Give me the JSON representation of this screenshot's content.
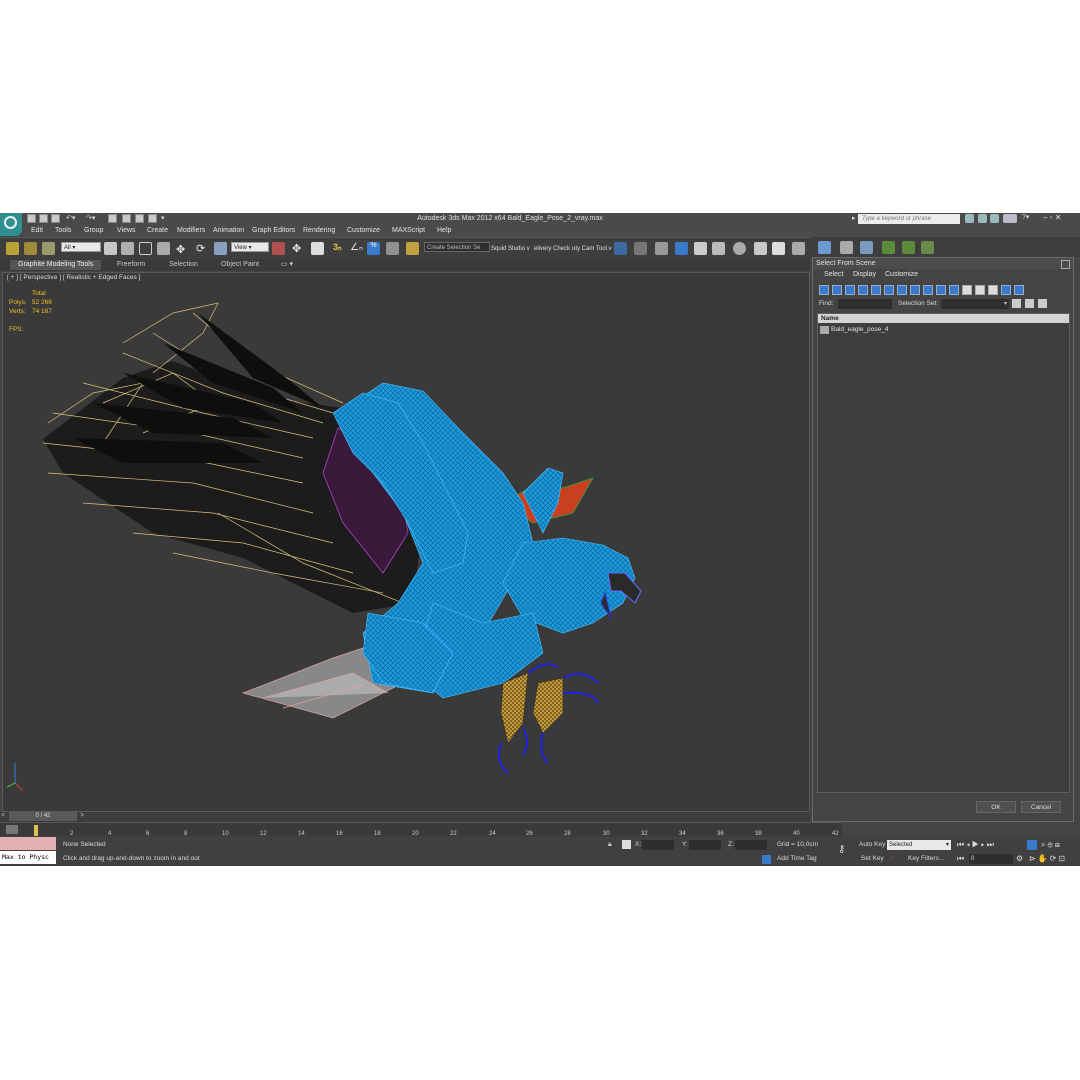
{
  "window": {
    "title": "Autodesk 3ds Max  2012 x64      Bald_Eagle_Pose_2_vray.max",
    "search_placeholder": "Type a keyword or phrase"
  },
  "menu": [
    "Edit",
    "Tools",
    "Group",
    "Views",
    "Create",
    "Modifiers",
    "Animation",
    "Graph Editors",
    "Rendering",
    "Customize",
    "MAXScript",
    "Help"
  ],
  "toolbar": {
    "selection_filter": "All",
    "ref_coord": "View",
    "named_selection": "Create Selection Se",
    "text_a": "Squid Studio v",
    "text_b": "elivery Check",
    "text_c": "uty Cam Tool v"
  },
  "ribbon": {
    "tabs": [
      "Graphite Modeling Tools",
      "Freeform",
      "Selection",
      "Object Paint"
    ]
  },
  "viewport": {
    "label": "[ + ] [ Perspective ] [ Realistic + Edged Faces ]",
    "stats": {
      "total_label": "Total",
      "polys_label": "Polys:",
      "polys_value": "52 266",
      "verts_label": "Verts:",
      "verts_value": "74 187",
      "fps_label": "FPS:"
    }
  },
  "timeline": {
    "frame": "0 / 42",
    "ticks": [
      "2",
      "4",
      "6",
      "8",
      "10",
      "12",
      "14",
      "16",
      "18",
      "20",
      "22",
      "24",
      "26",
      "28",
      "30",
      "32",
      "34",
      "36",
      "38",
      "40",
      "42"
    ]
  },
  "status": {
    "maxscript_listener": "Max to Physc",
    "selection": "None Selected",
    "prompt": "Click and drag up-and-down to zoom in and out",
    "x_label": "X:",
    "y_label": "Y:",
    "z_label": "Z:",
    "grid": "Grid = 10,0cm",
    "add_time_tag": "Add Time Tag",
    "auto_key": "Auto Key",
    "set_key": "Set Key",
    "key_mode": "Selected",
    "key_filters": "Key Filters...",
    "current_frame": "0"
  },
  "dialog": {
    "title": "Select From Scene",
    "menu": [
      "Select",
      "Display",
      "Customize"
    ],
    "find_label": "Find:",
    "selection_set_label": "Selection Set:",
    "column_name": "Name",
    "items": [
      "Bald_eagle_pose_4"
    ],
    "ok": "OK",
    "cancel": "Cancel"
  },
  "colors": {
    "wireframe": "#1a9be0",
    "wing_lines": "#d8c27a",
    "stats_text": "#f0c020",
    "accent_button": "#3a7acb"
  }
}
